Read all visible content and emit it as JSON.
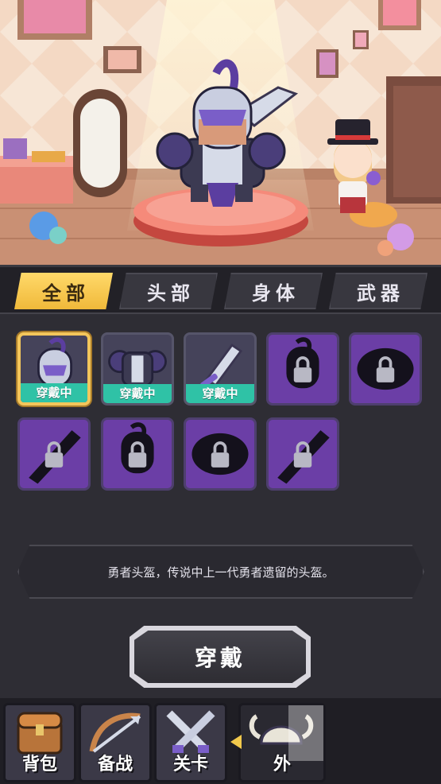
{
  "tabs": [
    {
      "label": "全部",
      "active": true
    },
    {
      "label": "头部",
      "active": false
    },
    {
      "label": "身体",
      "active": false
    },
    {
      "label": "武器",
      "active": false
    }
  ],
  "equipment_slots": [
    {
      "item": "helmet-icon",
      "badge": "穿戴中",
      "state": "equipped",
      "selected": true
    },
    {
      "item": "armor-icon",
      "badge": "穿戴中",
      "state": "equipped",
      "selected": false
    },
    {
      "item": "sword-icon",
      "badge": "穿戴中",
      "state": "equipped",
      "selected": false
    },
    {
      "item": "locked-helmet-icon",
      "state": "locked"
    },
    {
      "item": "locked-armor-icon",
      "state": "locked"
    },
    {
      "item": "locked-sword-icon",
      "state": "locked"
    },
    {
      "item": "locked-helmet-icon",
      "state": "locked"
    },
    {
      "item": "locked-armor-icon",
      "state": "locked"
    },
    {
      "item": "locked-sword-icon",
      "state": "locked"
    }
  ],
  "description": "勇者头盔，传说中上一代勇者遗留的头盔。",
  "action_button": "穿戴",
  "bottom_nav": [
    {
      "label": "背包",
      "icon": "treasure-chest-icon"
    },
    {
      "label": "备战",
      "icon": "bow-arrow-icon"
    },
    {
      "label": "关卡",
      "icon": "crossed-swords-icon"
    },
    {
      "label": "外",
      "icon": "viking-helmet-icon"
    }
  ],
  "colors": {
    "accent_gold": "#f3c65b",
    "equipped_badge": "#2fc2a6",
    "locked_slot": "#6b3ea6",
    "panel_bg": "#2e2d34"
  }
}
